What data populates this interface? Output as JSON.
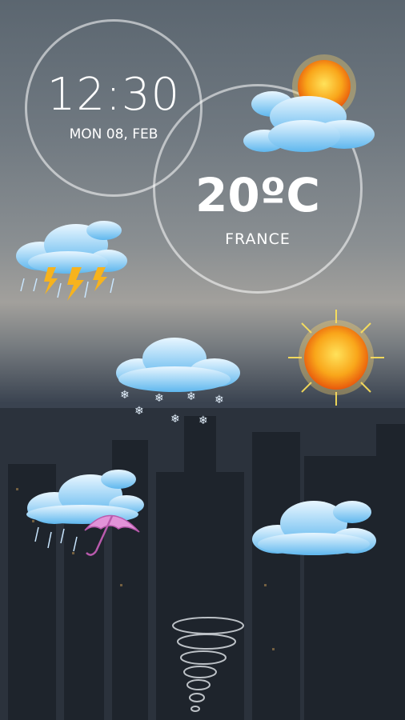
{
  "clock": {
    "time": "12:30",
    "date": "MON 08, FEB"
  },
  "weather": {
    "temperature": "20ºC",
    "location": "FRANCE"
  },
  "icons": [
    "partly-cloudy-icon",
    "thunderstorm-icon",
    "snow-cloud-icon",
    "sun-icon",
    "rain-umbrella-icon",
    "cloud-icon",
    "tornado-icon"
  ]
}
